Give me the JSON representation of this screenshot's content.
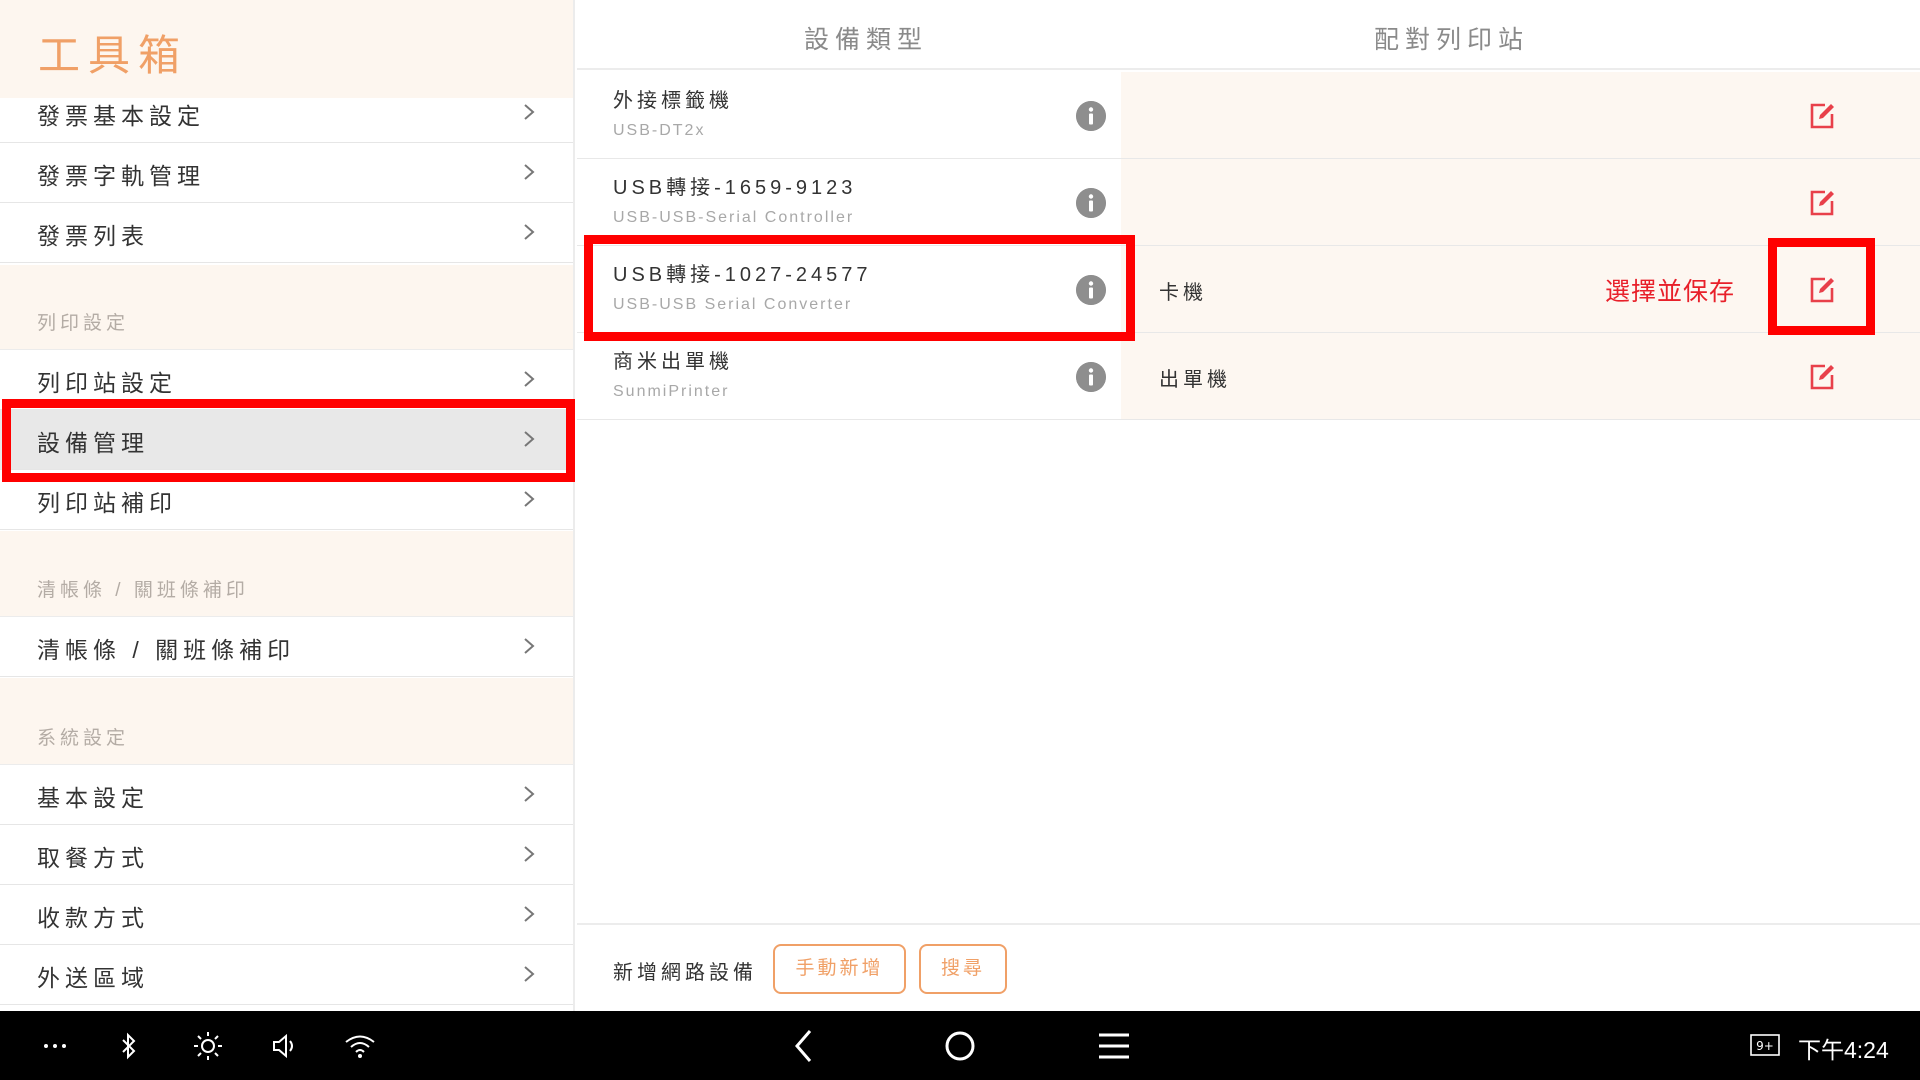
{
  "sidebar": {
    "title": "工具箱",
    "items": [
      {
        "label": "發票基本設定"
      },
      {
        "label": "發票字軌管理"
      },
      {
        "label": "發票列表"
      },
      {
        "label": "列印站設定"
      },
      {
        "label": "設備管理"
      },
      {
        "label": "列印站補印"
      },
      {
        "label": "清帳條 / 關班條補印"
      },
      {
        "label": "基本設定"
      },
      {
        "label": "取餐方式"
      },
      {
        "label": "收款方式"
      },
      {
        "label": "外送區域"
      }
    ],
    "sections": [
      {
        "label": "列印設定"
      },
      {
        "label": "清帳條 / 關班條補印"
      },
      {
        "label": "系統設定"
      }
    ],
    "active_item": "設備管理"
  },
  "main": {
    "columns": {
      "device_type": "設備類型",
      "paired_station": "配對列印站"
    },
    "devices": [
      {
        "name": "外接標籤機",
        "sub": "USB-DT2x",
        "station": ""
      },
      {
        "name": "USB轉接-1659-9123",
        "sub": "USB-USB-Serial Controller",
        "station": ""
      },
      {
        "name": "USB轉接-1027-24577",
        "sub": "USB-USB Serial Converter",
        "station": "卡機"
      },
      {
        "name": "商米出單機",
        "sub": "SunmiPrinter",
        "station": "出單機"
      }
    ],
    "annotation": "選擇並保存",
    "footer": {
      "label": "新增網路設備",
      "manual_add": "手動新增",
      "search": "搜尋"
    }
  },
  "system_bar": {
    "icons": [
      "more-icon",
      "bluetooth-icon",
      "brightness-icon",
      "volume-icon",
      "wifi-icon",
      "back-icon",
      "home-icon",
      "menu-icon",
      "notification-count-icon"
    ],
    "notification_badge": "9+",
    "time": "下午4:24"
  },
  "colors": {
    "accent": "#f0a067",
    "highlight_box": "#ff0000",
    "edit_icon": "#e8404a",
    "annotation_text": "#e8202a",
    "section_bg": "#fdf6ef"
  }
}
